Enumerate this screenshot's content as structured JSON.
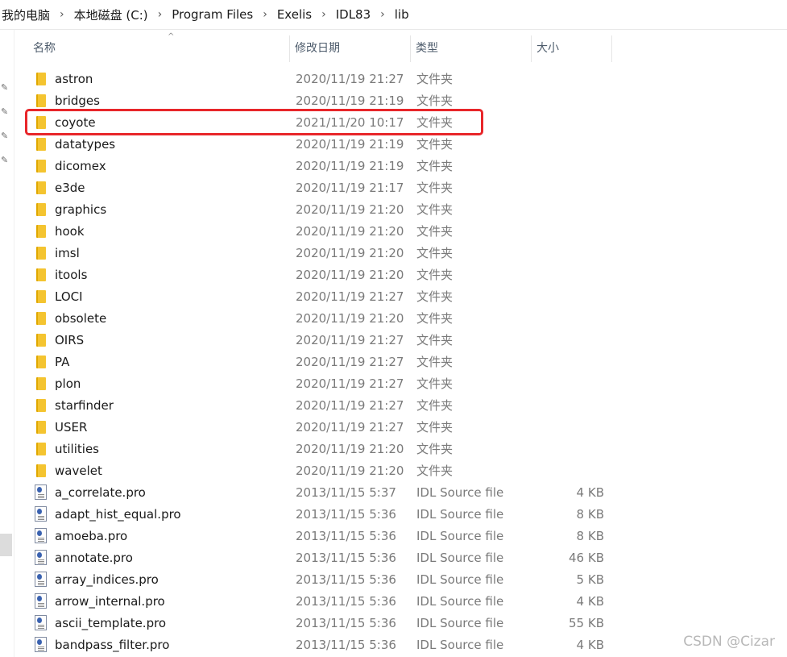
{
  "breadcrumb": [
    "我的电脑",
    "本地磁盘 (C:)",
    "Program Files",
    "Exelis",
    "IDL83",
    "lib"
  ],
  "breadcrumb_separator": "›",
  "columns": {
    "name": "名称",
    "date": "修改日期",
    "type": "类型",
    "size": "大小"
  },
  "sort_indicator": "^",
  "items": [
    {
      "kind": "folder",
      "name": "astron",
      "date": "2020/11/19 21:27",
      "type": "文件夹",
      "size": ""
    },
    {
      "kind": "folder",
      "name": "bridges",
      "date": "2020/11/19 21:19",
      "type": "文件夹",
      "size": ""
    },
    {
      "kind": "folder",
      "name": "coyote",
      "date": "2021/11/20 10:17",
      "type": "文件夹",
      "size": ""
    },
    {
      "kind": "folder",
      "name": "datatypes",
      "date": "2020/11/19 21:19",
      "type": "文件夹",
      "size": ""
    },
    {
      "kind": "folder",
      "name": "dicomex",
      "date": "2020/11/19 21:19",
      "type": "文件夹",
      "size": ""
    },
    {
      "kind": "folder",
      "name": "e3de",
      "date": "2020/11/19 21:17",
      "type": "文件夹",
      "size": ""
    },
    {
      "kind": "folder",
      "name": "graphics",
      "date": "2020/11/19 21:20",
      "type": "文件夹",
      "size": ""
    },
    {
      "kind": "folder",
      "name": "hook",
      "date": "2020/11/19 21:20",
      "type": "文件夹",
      "size": ""
    },
    {
      "kind": "folder",
      "name": "imsl",
      "date": "2020/11/19 21:20",
      "type": "文件夹",
      "size": ""
    },
    {
      "kind": "folder",
      "name": "itools",
      "date": "2020/11/19 21:20",
      "type": "文件夹",
      "size": ""
    },
    {
      "kind": "folder",
      "name": "LOCI",
      "date": "2020/11/19 21:27",
      "type": "文件夹",
      "size": ""
    },
    {
      "kind": "folder",
      "name": "obsolete",
      "date": "2020/11/19 21:20",
      "type": "文件夹",
      "size": ""
    },
    {
      "kind": "folder",
      "name": "OIRS",
      "date": "2020/11/19 21:27",
      "type": "文件夹",
      "size": ""
    },
    {
      "kind": "folder",
      "name": "PA",
      "date": "2020/11/19 21:27",
      "type": "文件夹",
      "size": ""
    },
    {
      "kind": "folder",
      "name": "plon",
      "date": "2020/11/19 21:27",
      "type": "文件夹",
      "size": ""
    },
    {
      "kind": "folder",
      "name": "starfinder",
      "date": "2020/11/19 21:27",
      "type": "文件夹",
      "size": ""
    },
    {
      "kind": "folder",
      "name": "USER",
      "date": "2020/11/19 21:27",
      "type": "文件夹",
      "size": ""
    },
    {
      "kind": "folder",
      "name": "utilities",
      "date": "2020/11/19 21:20",
      "type": "文件夹",
      "size": ""
    },
    {
      "kind": "folder",
      "name": "wavelet",
      "date": "2020/11/19 21:20",
      "type": "文件夹",
      "size": ""
    },
    {
      "kind": "file",
      "name": "a_correlate.pro",
      "date": "2013/11/15 5:37",
      "type": "IDL Source file",
      "size": "4 KB"
    },
    {
      "kind": "file",
      "name": "adapt_hist_equal.pro",
      "date": "2013/11/15 5:36",
      "type": "IDL Source file",
      "size": "8 KB"
    },
    {
      "kind": "file",
      "name": "amoeba.pro",
      "date": "2013/11/15 5:36",
      "type": "IDL Source file",
      "size": "8 KB"
    },
    {
      "kind": "file",
      "name": "annotate.pro",
      "date": "2013/11/15 5:36",
      "type": "IDL Source file",
      "size": "46 KB"
    },
    {
      "kind": "file",
      "name": "array_indices.pro",
      "date": "2013/11/15 5:36",
      "type": "IDL Source file",
      "size": "5 KB"
    },
    {
      "kind": "file",
      "name": "arrow_internal.pro",
      "date": "2013/11/15 5:36",
      "type": "IDL Source file",
      "size": "4 KB"
    },
    {
      "kind": "file",
      "name": "ascii_template.pro",
      "date": "2013/11/15 5:36",
      "type": "IDL Source file",
      "size": "55 KB"
    },
    {
      "kind": "file",
      "name": "bandpass_filter.pro",
      "date": "2013/11/15 5:36",
      "type": "IDL Source file",
      "size": "4 KB"
    }
  ],
  "highlighted_item": "coyote",
  "highlight_color": "#e8262a",
  "watermark": "CSDN @Cizar"
}
